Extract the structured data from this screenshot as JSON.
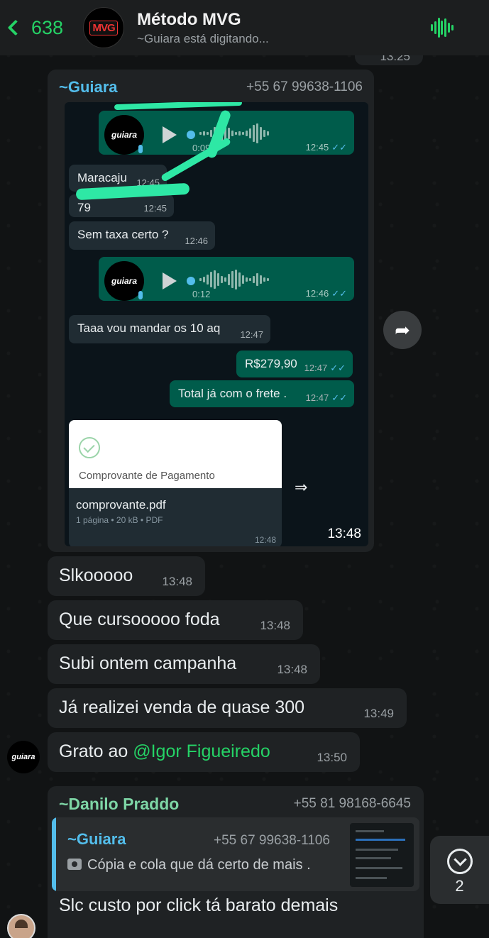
{
  "header": {
    "back_count": "638",
    "group_logo": "MVG",
    "title": "Método MVG",
    "status": "~Guiara está digitando..."
  },
  "top_stub_time": "13:25",
  "screenshot_message": {
    "sender": "~Guiara",
    "phone": "+55 67 99638-1106",
    "time": "13:48",
    "inner": {
      "audio1": {
        "avatar_text": "guiara",
        "duration": "0:09",
        "time": "12:45",
        "ticks": "✓✓"
      },
      "msg_maracaju": {
        "text": "Maracaju",
        "time": "12:45"
      },
      "msg_hidden": {
        "text": "79",
        "time": "12:45"
      },
      "msg_sem_taxa": {
        "text": "Sem taxa certo ?",
        "time": "12:46"
      },
      "audio2": {
        "avatar_text": "guiara",
        "duration": "0:12",
        "time": "12:46",
        "ticks": "✓✓"
      },
      "msg_taaa": {
        "text": "Taaa vou mandar os 10 aq",
        "time": "12:47"
      },
      "msg_price": {
        "text": "R$279,90",
        "time": "12:47",
        "ticks": "✓✓"
      },
      "msg_total": {
        "text": "Total já com o frete .",
        "time": "12:47",
        "ticks": "✓✓"
      },
      "document": {
        "preview_title": "Comprovante de Pagamento",
        "filename": "comprovante.pdf",
        "meta": "1 página • 20 kB • PDF",
        "time": "12:48"
      }
    }
  },
  "messages": [
    {
      "text": "Slkooooo",
      "time": "13:48"
    },
    {
      "text": "Que cursooooo foda",
      "time": "13:48"
    },
    {
      "text": "Subi ontem campanha",
      "time": "13:48"
    },
    {
      "text": "Já realizei venda de quase 300",
      "time": "13:49"
    },
    {
      "prefix": "Grato ao ",
      "mention": "@Igor Figueiredo",
      "time": "13:50"
    }
  ],
  "avatar_guiara_text": "guiara",
  "reply_message": {
    "sender": "~Danilo Praddo",
    "phone": "+55 81 98168-6645",
    "quote": {
      "sender": "~Guiara",
      "phone": "+55 67 99638-1106",
      "text": "Cópia e cola que dá certo de mais ."
    },
    "text": "Slc custo por click tá barato demais"
  },
  "scroll_down": {
    "count": "2"
  },
  "colors": {
    "accent": "#25d366",
    "outgoing_bubble": "#005c4b",
    "incoming_bubble": "#1f2224",
    "link_blue": "#53bdeb"
  }
}
